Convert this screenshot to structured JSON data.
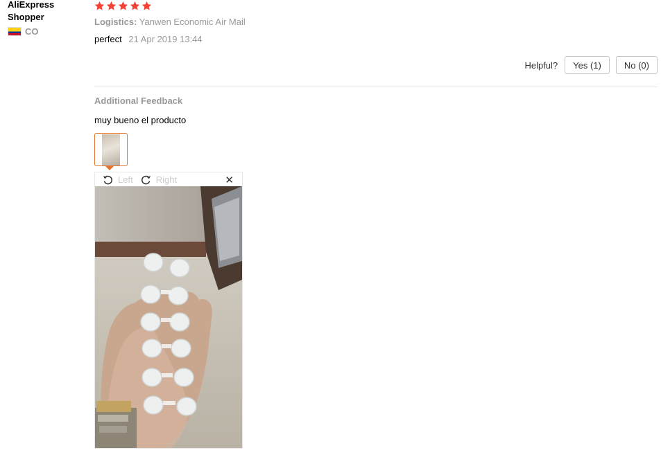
{
  "user": {
    "name": "AliExpress Shopper",
    "country": "CO"
  },
  "review": {
    "rating": 5,
    "logistics_label": "Logistics:",
    "logistics_value": "Yanwen Economic Air Mail",
    "comment": "perfect",
    "date": "21 Apr 2019 13:44",
    "helpful_label": "Helpful?",
    "yes_label": "Yes (1)",
    "no_label": "No (0)"
  },
  "additional_feedback": {
    "heading": "Additional Feedback",
    "text": "muy bueno el producto"
  },
  "image_viewer": {
    "rotate_left_label": "Left",
    "rotate_right_label": "Right",
    "close_icon": "close-icon",
    "rotate_left_icon": "rotate-left-icon",
    "rotate_right_icon": "rotate-right-icon"
  },
  "colors": {
    "star": "#f44336",
    "thumb_border": "#e4742b",
    "muted_text": "#999999"
  }
}
